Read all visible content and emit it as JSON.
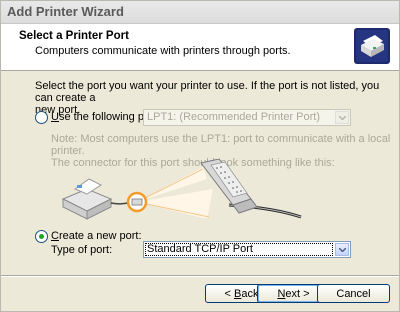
{
  "window": {
    "title": "Add Printer Wizard"
  },
  "header": {
    "title": "Select a Printer Port",
    "subtitle": "Computers communicate with printers through ports.",
    "icon": "printer-icon"
  },
  "intro": {
    "line1": "Select the port you want your printer to use.  If the port is not listed, you can create a",
    "line2": "new port."
  },
  "use_port": {
    "label_prefix": "",
    "label_underlined": "U",
    "label_rest": "se the following port:",
    "value": "LPT1: (Recommended Printer Port)",
    "selected": false
  },
  "note": {
    "line1": "Note: Most computers use the LPT1: port to communicate with a local printer.",
    "line2": "The connector for this port should look something like this:"
  },
  "create_port": {
    "label_prefix": "",
    "label_underlined": "C",
    "label_rest": "reate a new port:",
    "type_label": "Type of port:",
    "value": "Standard TCP/IP Port",
    "selected": true
  },
  "buttons": {
    "back_underlined": "B",
    "back_rest": "ack",
    "back_prefix": "< ",
    "next_underlined": "N",
    "next_rest": "ext >",
    "cancel": "Cancel"
  },
  "colors": {
    "accent": "#21a121",
    "highlight": "#f39a28"
  }
}
